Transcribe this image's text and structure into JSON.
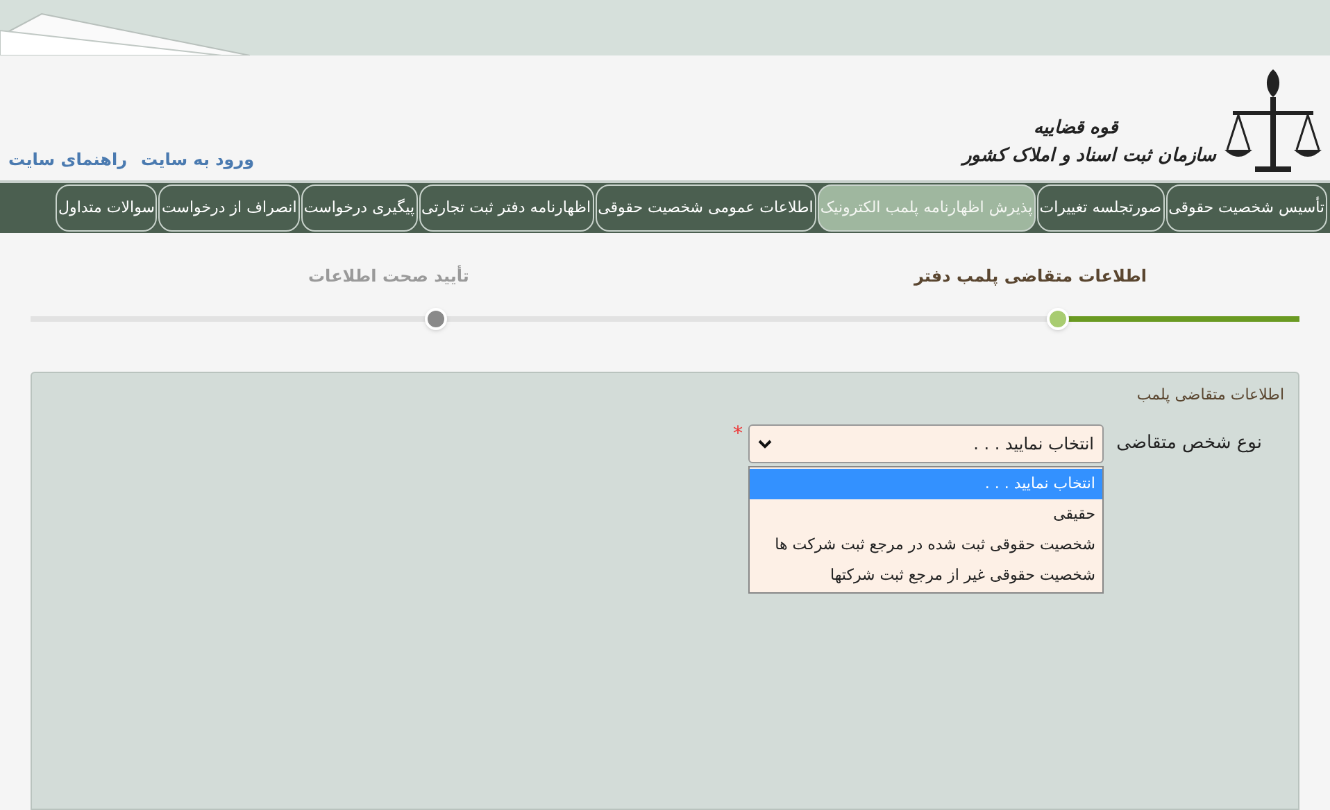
{
  "header": {
    "logo_top": "قوه قضاییه",
    "logo_bottom": "سازمان ثبت اسناد و املاک کشور",
    "links": [
      "ورود به سایت",
      "راهنمای سایت"
    ]
  },
  "nav": [
    {
      "label": "تأسیس شخصیت حقوقی",
      "selected": false
    },
    {
      "label": "صورتجلسه تغییرات",
      "selected": false
    },
    {
      "label": "پذیرش اظهارنامه پلمب الکترونیک",
      "selected": true
    },
    {
      "label": "اطلاعات عمومی شخصیت حقوقی",
      "selected": false
    },
    {
      "label": "اظهارنامه دفتر ثبت تجارتی",
      "selected": false
    },
    {
      "label": "پیگیری درخواست",
      "selected": false
    },
    {
      "label": "انصراف از درخواست",
      "selected": false
    },
    {
      "label": "سوالات متداول",
      "selected": false
    }
  ],
  "stepper": {
    "level": 0.19,
    "steps": [
      {
        "label": "اطلاعات متقاضی پلمب دفتر",
        "active": true
      },
      {
        "label": "تأیید صحت اطلاعات",
        "active": false
      }
    ]
  },
  "panel": {
    "title": "اطلاعات متقاضی پلمب",
    "field": {
      "label": "نوع شخص متقاضی",
      "required_mark": "*",
      "value": "انتخاب نمایید . . .",
      "expanded": true,
      "options": [
        {
          "label": "انتخاب نمایید . . .",
          "selected": true
        },
        {
          "label": "حقیقی",
          "selected": false
        },
        {
          "label": "شخصیت حقوقی ثبت شده در مرجع ثبت شرکت ها",
          "selected": false
        },
        {
          "label": "شخصیت حقوقی غیر از مرجع ثبت شرکتها",
          "selected": false
        }
      ]
    }
  }
}
